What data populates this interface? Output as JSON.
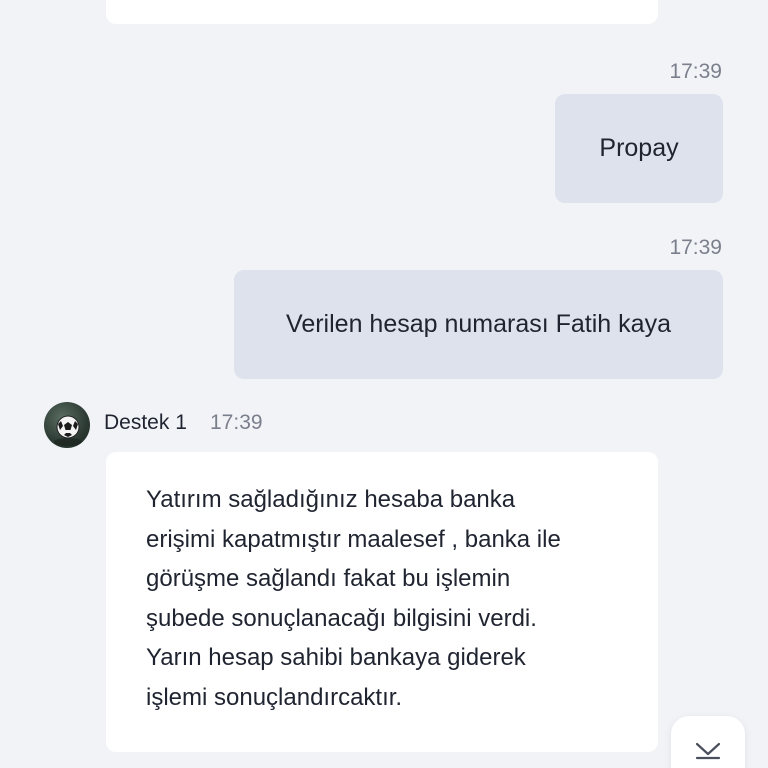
{
  "colors": {
    "background": "#f2f3f7",
    "incoming_bubble": "#ffffff",
    "outgoing_bubble": "#dde2ed",
    "timestamp": "#7a7f8c",
    "text": "#1f2430"
  },
  "messages": [
    {
      "direction": "outgoing",
      "time": "17:39",
      "text": "Propay"
    },
    {
      "direction": "outgoing",
      "time": "17:39",
      "text": "Verilen hesap numarası Fatih kaya"
    },
    {
      "direction": "incoming",
      "sender": "Destek 1",
      "time": "17:39",
      "avatar_icon": "soccer-ball-avatar",
      "text": "Yatırım sağladığınız hesaba banka\nerişimi kapatmıştır maalesef , banka ile\ngörüşme sağlandı fakat bu işlemin\nşubede sonuçlanacağı bilgisini verdi.\nYarın hesap sahibi bankaya giderek\nişlemi sonuçlandırcaktır."
    }
  ],
  "scroll_button": {
    "icon": "chevron-down-icon"
  }
}
